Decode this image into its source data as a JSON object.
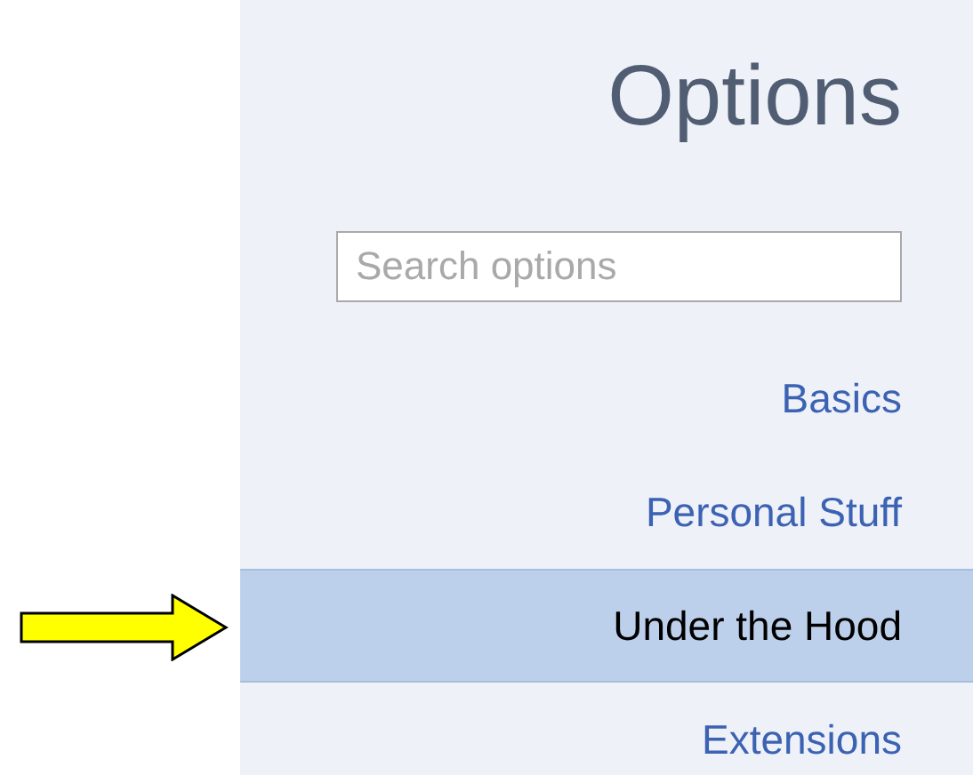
{
  "title": "Options",
  "search": {
    "placeholder": "Search options"
  },
  "nav": [
    {
      "label": "Basics",
      "selected": false
    },
    {
      "label": "Personal Stuff",
      "selected": false
    },
    {
      "label": "Under the Hood",
      "selected": true
    },
    {
      "label": "Extensions",
      "selected": false
    }
  ]
}
